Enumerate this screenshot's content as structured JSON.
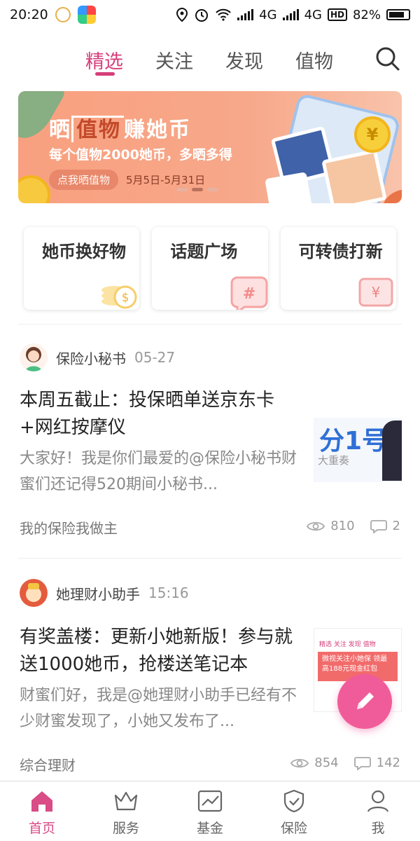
{
  "status_bar": {
    "time": "20:20",
    "network1": "4G",
    "network2": "4G",
    "hd": "HD",
    "battery": "82%",
    "battery_level": 0.82
  },
  "top_tabs": {
    "items": [
      "精选",
      "关注",
      "发现",
      "值物"
    ],
    "active_index": 0
  },
  "banner": {
    "title_pre": "晒",
    "title_highlight": "值物",
    "title_post": "赚她币",
    "subtitle": "每个值物2000她币，多晒多得",
    "button": "点我晒值物",
    "date_range": "5月5日-5月31日",
    "coin_symbol": "¥"
  },
  "quick_cards": [
    {
      "label": "她币换好物"
    },
    {
      "label": "话题广场"
    },
    {
      "label": "可转债打新"
    }
  ],
  "feed": [
    {
      "author": "保险小秘书",
      "time": "05-27",
      "title": "本周五截止：投保晒单送京东卡+网红按摩仪",
      "body": "大家好！我是你们最爱的@保险小秘书财蜜们还记得520期间小秘书...",
      "tag": "我的保险我做主",
      "views": "810",
      "comments": "2",
      "thumb_text": "分1号",
      "thumb_sub": "大重奏"
    },
    {
      "author": "她理财小助手",
      "time": "15:16",
      "title": "有奖盖楼：更新小她新版！参与就送1000她币，抢楼送笔记本",
      "body": "财蜜们好，我是@她理财小助手已经有不少财蜜发现了，小她又发布了...",
      "tag": "综合理财",
      "views": "854",
      "comments": "142",
      "thumb_tabs": "精选  关注  发现  值物",
      "thumb_banner": "微视关注小她保 领最高188元现金红包"
    }
  ],
  "bottom_nav": {
    "items": [
      "首页",
      "服务",
      "基金",
      "保险",
      "我"
    ],
    "active_index": 0
  },
  "colors": {
    "accent": "#d63f7b",
    "banner_bg": "#f8a07f",
    "fab": "#f05c9a"
  }
}
